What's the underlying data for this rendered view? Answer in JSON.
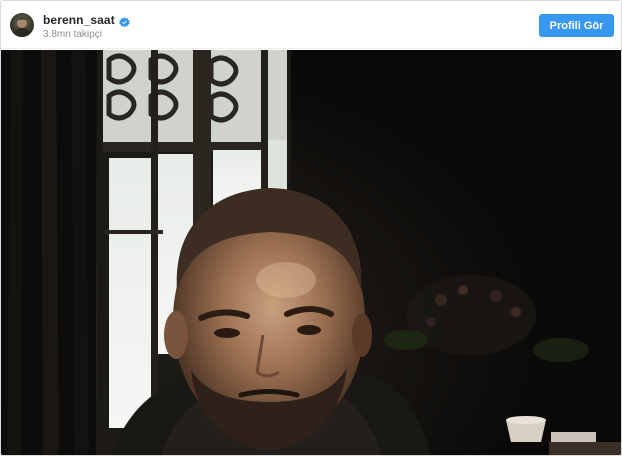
{
  "post": {
    "username": "berenn_saat",
    "followers": "3.8mn takipçi",
    "profile_button": "Profili Gör"
  },
  "icons": {
    "verified": "verified-badge-icon",
    "avatar": "profile-avatar"
  },
  "colors": {
    "accent": "#3897f0",
    "username": "#262626",
    "muted": "#8e8e8e"
  }
}
